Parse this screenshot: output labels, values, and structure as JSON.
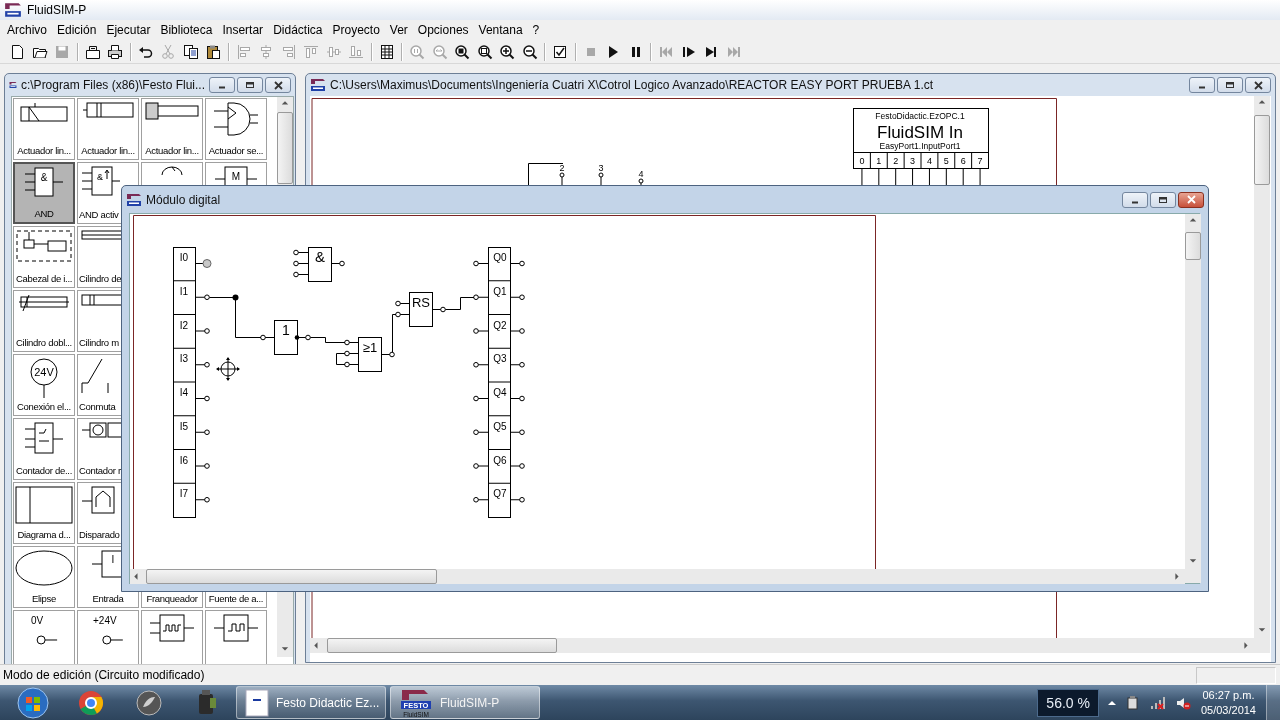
{
  "window": {
    "title": "FluidSIM-P"
  },
  "menu": [
    "Archivo",
    "Edición",
    "Ejecutar",
    "Biblioteca",
    "Insertar",
    "Didáctica",
    "Proyecto",
    "Ver",
    "Opciones",
    "Ventana",
    "?"
  ],
  "toolbar": [
    [
      {
        "disabled": false
      },
      {
        "disabled": false
      },
      {
        "disabled": true
      }
    ],
    [
      {
        "disabled": false
      },
      {
        "disabled": false
      }
    ],
    [
      {
        "disabled": false
      },
      {
        "disabled": true
      },
      {
        "disabled": false
      },
      {
        "disabled": false
      }
    ],
    [
      {
        "disabled": true
      },
      {
        "disabled": true
      },
      {
        "disabled": true
      },
      {
        "disabled": true
      },
      {
        "disabled": true
      },
      {
        "disabled": true
      }
    ],
    [
      {
        "disabled": false
      }
    ],
    [
      {
        "disabled": true
      },
      {
        "disabled": true
      },
      {
        "disabled": false
      },
      {
        "disabled": false
      },
      {
        "disabled": false
      },
      {
        "disabled": false
      }
    ],
    [
      {
        "disabled": false
      }
    ],
    [
      {
        "disabled": true
      },
      {
        "disabled": false
      },
      {
        "disabled": false
      }
    ],
    [
      {
        "disabled": true
      },
      {
        "disabled": false
      },
      {
        "disabled": false
      },
      {
        "disabled": true
      }
    ]
  ],
  "library": {
    "title": "c:\\Program Files (x86)\\Festo Flui...",
    "active": false,
    "rows": [
      [
        {
          "label": "Actuador lin...",
          "selected": false
        },
        {
          "label": "Actuador lin...",
          "selected": false
        },
        {
          "label": "Actuador lin...",
          "selected": false
        },
        {
          "label": "Actuador se...",
          "selected": false
        }
      ],
      [
        {
          "label": "AND",
          "symbol": "&",
          "selected": true
        },
        {
          "label": "AND activ",
          "symbol": "&",
          "selected": false
        },
        {
          "selected": false
        },
        {
          "symbol": "M",
          "selected": false
        }
      ],
      [
        {
          "label": "Cabezal de i...",
          "selected": false
        },
        {
          "label": "Cilindro de",
          "selected": false
        }
      ],
      [
        {
          "label": "Cilindro dobl...",
          "selected": false
        },
        {
          "label": "Cilindro m",
          "selected": false
        }
      ],
      [
        {
          "label": "Conexión el...",
          "symbol": "24V",
          "selected": false
        },
        {
          "label": "Conmuta",
          "selected": false
        }
      ],
      [
        {
          "label": "Contador de...",
          "selected": false
        },
        {
          "label": "Contador r",
          "selected": false
        }
      ],
      [
        {
          "label": "Diagrama d...",
          "selected": false
        },
        {
          "label": "Disparado",
          "selected": false
        }
      ],
      [
        {
          "label": "Elipse",
          "selected": false
        },
        {
          "label": "Entrada",
          "symbol": "I",
          "selected": false
        },
        {
          "label": "Franqueador",
          "selected": false
        },
        {
          "label": "Fuente de a...",
          "selected": false
        }
      ],
      [
        {
          "symbol": "0V",
          "selected": false
        },
        {
          "symbol": "+24V",
          "selected": false
        },
        {
          "selected": false
        },
        {
          "selected": false
        }
      ]
    ]
  },
  "document": {
    "title": "C:\\Users\\Maximus\\Documents\\Ingeniería Cuatri X\\Cotrol Logico Avanzado\\REACTOR EASY PORT PRUEBA 1.ct",
    "active": false,
    "block": {
      "server": "FestoDidactic.EzOPC.1",
      "name": "FluidSIM In",
      "port": "EasyPort1.InputPort1",
      "pins": [
        "0",
        "1",
        "2",
        "3",
        "4",
        "5",
        "6",
        "7"
      ]
    },
    "terminal_numbers": [
      "2",
      "3",
      "4"
    ]
  },
  "module": {
    "title": "Módulo digital",
    "active": true,
    "inputs": [
      "I0",
      "I1",
      "I2",
      "I3",
      "I4",
      "I5",
      "I6",
      "I7"
    ],
    "outputs": [
      "Q0",
      "Q1",
      "Q2",
      "Q3",
      "Q4",
      "Q5",
      "Q6",
      "Q7"
    ],
    "gates": [
      {
        "symbol": "&"
      },
      {
        "symbol": "1"
      },
      {
        "symbol": "≥1"
      },
      {
        "symbol": "RS"
      }
    ]
  },
  "status_bar": {
    "text": "Modo de edición (Circuito modificado)"
  },
  "taskbar": {
    "tasks": [
      {
        "label": "Festo Didactic Ez...",
        "selected": false
      },
      {
        "label": "FluidSIM-P",
        "selected": true,
        "logo_text": [
          "FESTO",
          "FluidSIM"
        ]
      }
    ],
    "badge": "56.0 %",
    "time": "06:27 p.m.",
    "date": "05/03/2014"
  }
}
